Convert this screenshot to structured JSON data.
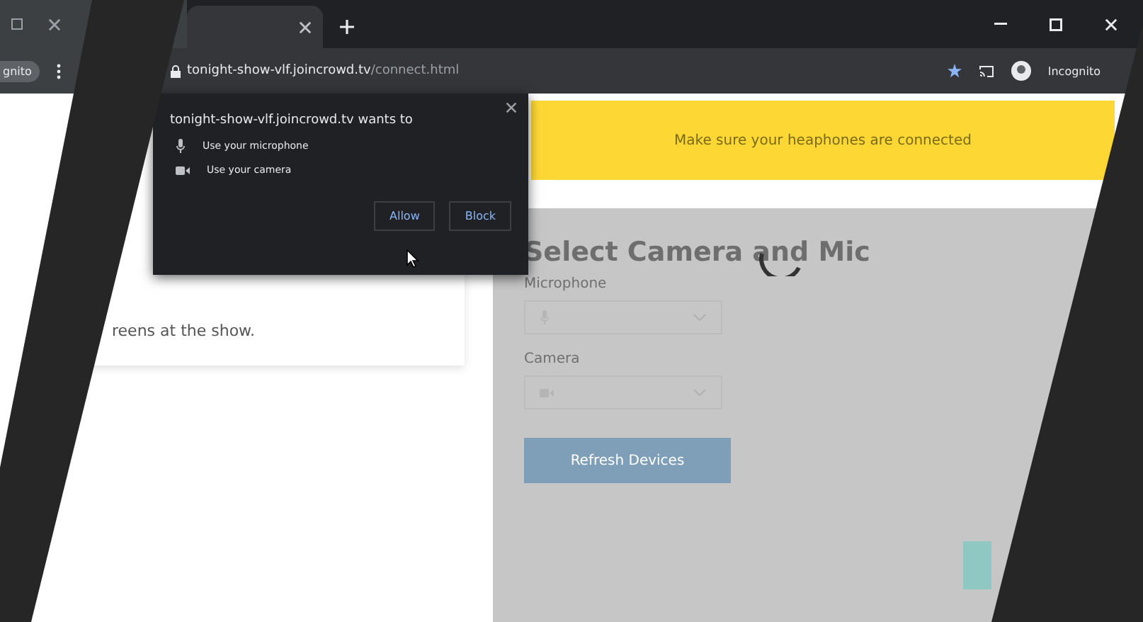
{
  "left_window": {
    "profile_fragment": "gnito"
  },
  "address_bar": {
    "host": "tonight-show-vlf.joincrowd.tv",
    "path": "/connect.html"
  },
  "profile": {
    "label": "Incognito"
  },
  "permission_popup": {
    "title": "tonight-show-vlf.joincrowd.tv wants to",
    "permissions": [
      {
        "kind": "microphone",
        "label": "Use your microphone"
      },
      {
        "kind": "camera",
        "label": "Use your camera"
      }
    ],
    "buttons": [
      "Allow",
      "Block"
    ]
  },
  "card": {
    "lines": [
      "reens at the show."
    ]
  },
  "banner": {
    "text": "Make sure your heaphones are connected"
  },
  "device_form": {
    "title": "Select Camera and Mic",
    "loading": true,
    "fields": [
      {
        "kind": "microphone",
        "label": "Microphone"
      },
      {
        "kind": "camera",
        "label": "Camera"
      }
    ],
    "refresh_button": "Refresh Devices"
  }
}
